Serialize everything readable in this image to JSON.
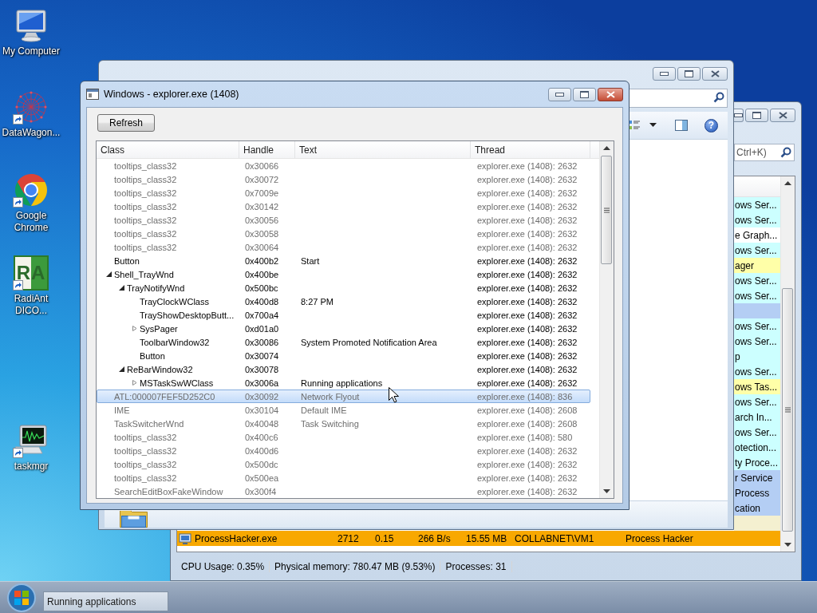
{
  "desktop_icons": [
    {
      "kind": "computer",
      "label": "My Computer",
      "shortcut": false
    },
    {
      "kind": "network",
      "label": "DataWagon...",
      "shortcut": true
    },
    {
      "kind": "browser",
      "label": "Google Chrome",
      "shortcut": true
    },
    {
      "kind": "logo",
      "logo_text": "RA",
      "label": "RadiAnt DICO...",
      "shortcut": true
    },
    {
      "kind": "activity",
      "label": "taskmgr",
      "shortcut": true
    }
  ],
  "process_window": {
    "search": {
      "placeholder": "Ctrl+K)"
    },
    "rows": [
      {
        "kind": "partial",
        "cells": [
          "ows Ser..."
        ],
        "color": "#ccffff"
      },
      {
        "kind": "partial",
        "cells": [
          "ows Ser..."
        ],
        "color": "#ccffff"
      },
      {
        "kind": "partial",
        "cells": [
          "e Graph..."
        ],
        "color": "#ffffff"
      },
      {
        "kind": "partial",
        "cells": [
          "ows Ser..."
        ],
        "color": "#ccffff"
      },
      {
        "kind": "partial",
        "cells": [
          "ager"
        ],
        "color": "#ffffa8"
      },
      {
        "kind": "partial",
        "cells": [
          "ows Ser..."
        ],
        "color": "#ccffff"
      },
      {
        "kind": "partial",
        "cells": [
          "ows Ser..."
        ],
        "color": "#ccffff"
      },
      {
        "kind": "partial",
        "color": "#b4cef4"
      },
      {
        "kind": "partial",
        "cells": [
          "ows Ser..."
        ],
        "color": "#ccffff"
      },
      {
        "kind": "partial",
        "cells": [
          "ows Ser..."
        ],
        "color": "#ccffff"
      },
      {
        "kind": "partial",
        "cells": [
          "p"
        ],
        "color": "#ccffff"
      },
      {
        "kind": "partial",
        "cells": [
          "ows Ser..."
        ],
        "color": "#ccffff"
      },
      {
        "kind": "partial",
        "cells": [
          "ows Tas..."
        ],
        "color": "#ffffa8"
      },
      {
        "kind": "partial",
        "cells": [
          "ows Ser..."
        ],
        "color": "#ccffff"
      },
      {
        "kind": "partial",
        "cells": [
          "arch In..."
        ],
        "color": "#ccffff"
      },
      {
        "kind": "partial",
        "cells": [
          "ows Ser..."
        ],
        "color": "#ccffff"
      },
      {
        "kind": "partial",
        "cells": [
          "otection..."
        ],
        "color": "#ccffff"
      },
      {
        "kind": "partial",
        "cells": [
          "ty Proce..."
        ],
        "color": "#ccffff"
      },
      {
        "kind": "partial",
        "cells": [
          "r Service"
        ],
        "color": "#b4cef4"
      },
      {
        "kind": "partial",
        "cells": [
          "Process"
        ],
        "color": "#b4cef4"
      },
      {
        "kind": "partial",
        "cells": [
          "cation"
        ],
        "color": "#b4cef4"
      },
      {
        "kind": "partial",
        "color": "#f4f0d0"
      },
      {
        "kind": "full",
        "cells": [
          "ProcessHacker.exe",
          "2712",
          "0.15",
          "266 B/s",
          "15.55 MB",
          "COLLABNET\\VM1",
          "Process Hacker"
        ],
        "color": "#f8a800"
      }
    ],
    "status_bar": [
      "CPU Usage: 0.35%",
      "Physical memory: 780.47 MB (9.53%)",
      "Processes: 31"
    ]
  },
  "explorer_window": {
    "help_glyph": "?"
  },
  "dialog": {
    "title": "Windows - explorer.exe (1408)",
    "refresh_button": "Refresh",
    "columns": [
      "Class",
      "Handle",
      "Text",
      "Thread"
    ],
    "rows": [
      {
        "class": "tooltips_class32",
        "handle": "0x30066",
        "thread": "explorer.exe (1408): 2632",
        "visible": false,
        "selected": false
      },
      {
        "class": "tooltips_class32",
        "handle": "0x30072",
        "thread": "explorer.exe (1408): 2632",
        "visible": false,
        "selected": false
      },
      {
        "class": "tooltips_class32",
        "handle": "0x7009e",
        "thread": "explorer.exe (1408): 2632",
        "visible": false,
        "selected": false
      },
      {
        "class": "tooltips_class32",
        "handle": "0x30142",
        "thread": "explorer.exe (1408): 2632",
        "visible": false,
        "selected": false
      },
      {
        "class": "tooltips_class32",
        "handle": "0x30056",
        "thread": "explorer.exe (1408): 2632",
        "visible": false,
        "selected": false
      },
      {
        "class": "tooltips_class32",
        "handle": "0x30058",
        "thread": "explorer.exe (1408): 2632",
        "visible": false,
        "selected": false
      },
      {
        "class": "tooltips_class32",
        "handle": "0x30064",
        "thread": "explorer.exe (1408): 2632",
        "visible": false,
        "selected": false
      },
      {
        "class": "Button",
        "handle": "0x400b2",
        "text": "Start",
        "thread": "explorer.exe (1408): 2632",
        "visible": true,
        "selected": false
      },
      {
        "class": "Shell_TrayWnd",
        "handle": "0x400be",
        "thread": "explorer.exe (1408): 2632",
        "visible": true,
        "selected": false,
        "expanded": true,
        "children": [
          {
            "class": "TrayNotifyWnd",
            "handle": "0x500bc",
            "thread": "explorer.exe (1408): 2632",
            "visible": true,
            "selected": false,
            "expanded": true,
            "children": [
              {
                "class": "TrayClockWClass",
                "handle": "0x400d8",
                "text": "8:27 PM",
                "thread": "explorer.exe (1408): 2632",
                "visible": true,
                "selected": false
              },
              {
                "class": "TrayShowDesktopButt...",
                "handle": "0x700a4",
                "thread": "explorer.exe (1408): 2632",
                "visible": true,
                "selected": false
              },
              {
                "class": "SysPager",
                "handle": "0xd01a0",
                "thread": "explorer.exe (1408): 2632",
                "visible": true,
                "selected": false,
                "expanded": false
              },
              {
                "class": "ToolbarWindow32",
                "handle": "0x30086",
                "text": "System Promoted Notification Area",
                "thread": "explorer.exe (1408): 2632",
                "visible": true,
                "selected": false
              },
              {
                "class": "Button",
                "handle": "0x30074",
                "thread": "explorer.exe (1408): 2632",
                "visible": true,
                "selected": false
              }
            ]
          },
          {
            "class": "ReBarWindow32",
            "handle": "0x30078",
            "thread": "explorer.exe (1408): 2632",
            "visible": true,
            "selected": false,
            "expanded": true,
            "children": [
              {
                "class": "MSTaskSwWClass",
                "handle": "0x3006a",
                "text": "Running applications",
                "thread": "explorer.exe (1408): 2632",
                "visible": true,
                "selected": false,
                "expanded": false
              }
            ]
          }
        ]
      },
      {
        "class": "ATL:000007FEF5D252C0",
        "handle": "0x30092",
        "text": "Network Flyout",
        "thread": "explorer.exe (1408): 836",
        "visible": false,
        "selected": true
      },
      {
        "class": "IME",
        "handle": "0x30104",
        "text": "Default IME",
        "thread": "explorer.exe (1408): 2608",
        "visible": false,
        "selected": false
      },
      {
        "class": "TaskSwitcherWnd",
        "handle": "0x40048",
        "text": "Task Switching",
        "thread": "explorer.exe (1408): 2608",
        "visible": false,
        "selected": false
      },
      {
        "class": "tooltips_class32",
        "handle": "0x400c6",
        "thread": "explorer.exe (1408): 580",
        "visible": false,
        "selected": false
      },
      {
        "class": "tooltips_class32",
        "handle": "0x400d6",
        "thread": "explorer.exe (1408): 2632",
        "visible": false,
        "selected": false
      },
      {
        "class": "tooltips_class32",
        "handle": "0x500dc",
        "thread": "explorer.exe (1408): 2632",
        "visible": false,
        "selected": false
      },
      {
        "class": "tooltips_class32",
        "handle": "0x500ea",
        "thread": "explorer.exe (1408): 2632",
        "visible": false,
        "selected": false
      },
      {
        "class": "SearchEditBoxFakeWindow",
        "handle": "0x300f4",
        "thread": "explorer.exe (1408): 2632",
        "visible": false,
        "selected": false
      }
    ]
  },
  "taskbar": {
    "buttons": [
      {
        "label": "Running applications"
      }
    ]
  }
}
